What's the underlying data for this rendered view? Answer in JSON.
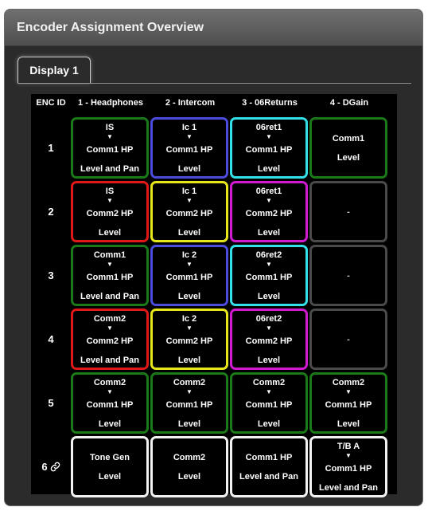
{
  "panel": {
    "title": "Encoder Assignment Overview"
  },
  "tabs": [
    {
      "label": "Display 1"
    }
  ],
  "grid": {
    "id_header": "ENC ID",
    "columns": [
      {
        "label": "1 - Headphones"
      },
      {
        "label": "2 - Intercom"
      },
      {
        "label": "3 - 06Returns"
      },
      {
        "label": "4 - DGain"
      }
    ],
    "colors": {
      "green": "#1a7a1a",
      "blue": "#4b4bdd",
      "cyan": "#33e0e8",
      "red": "#e01818",
      "yellow": "#e6e61a",
      "magenta": "#d21ad2",
      "gray": "#4a4a4a",
      "white": "#f2f2f2"
    },
    "arrow_glyph": "▼",
    "rows": [
      {
        "id": "1",
        "linked": false,
        "cells": [
          {
            "color": "green",
            "source": "IS",
            "target": "Comm1 HP",
            "mode": "Level and Pan"
          },
          {
            "color": "blue",
            "source": "Ic 1",
            "target": "Comm1 HP",
            "mode": "Level"
          },
          {
            "color": "cyan",
            "source": "06ret1",
            "target": "Comm1 HP",
            "mode": "Level"
          },
          {
            "color": "green",
            "source": "",
            "target": "Comm1",
            "mode": "Level"
          }
        ]
      },
      {
        "id": "2",
        "linked": false,
        "cells": [
          {
            "color": "red",
            "source": "IS",
            "target": "Comm2 HP",
            "mode": "Level"
          },
          {
            "color": "yellow",
            "source": "Ic 1",
            "target": "Comm2 HP",
            "mode": "Level"
          },
          {
            "color": "magenta",
            "source": "06ret1",
            "target": "Comm2 HP",
            "mode": "Level"
          },
          {
            "color": "gray",
            "empty": "-"
          }
        ]
      },
      {
        "id": "3",
        "linked": false,
        "cells": [
          {
            "color": "green",
            "source": "Comm1",
            "target": "Comm1 HP",
            "mode": "Level and Pan"
          },
          {
            "color": "blue",
            "source": "Ic 2",
            "target": "Comm1 HP",
            "mode": "Level"
          },
          {
            "color": "cyan",
            "source": "06ret2",
            "target": "Comm1 HP",
            "mode": "Level"
          },
          {
            "color": "gray",
            "empty": "-"
          }
        ]
      },
      {
        "id": "4",
        "linked": false,
        "cells": [
          {
            "color": "red",
            "source": "Comm2",
            "target": "Comm2 HP",
            "mode": "Level and Pan"
          },
          {
            "color": "yellow",
            "source": "Ic 2",
            "target": "Comm2 HP",
            "mode": "Level"
          },
          {
            "color": "magenta",
            "source": "06ret2",
            "target": "Comm2 HP",
            "mode": "Level"
          },
          {
            "color": "gray",
            "empty": "-"
          }
        ]
      },
      {
        "id": "5",
        "linked": false,
        "cells": [
          {
            "color": "green",
            "source": "Comm2",
            "target": "Comm1 HP",
            "mode": "Level"
          },
          {
            "color": "green",
            "source": "Comm2",
            "target": "Comm1 HP",
            "mode": "Level"
          },
          {
            "color": "green",
            "source": "Comm2",
            "target": "Comm1 HP",
            "mode": "Level"
          },
          {
            "color": "green",
            "source": "Comm2",
            "target": "Comm1 HP",
            "mode": "Level"
          }
        ]
      },
      {
        "id": "6",
        "linked": true,
        "cells": [
          {
            "color": "white",
            "source": "",
            "target": "Tone Gen",
            "mode": "Level"
          },
          {
            "color": "white",
            "source": "",
            "target": "Comm2",
            "mode": "Level"
          },
          {
            "color": "white",
            "source": "",
            "target": "Comm1 HP",
            "mode": "Level and Pan"
          },
          {
            "color": "white",
            "source": "T/B A",
            "target": "Comm1 HP",
            "mode": "Level and Pan"
          }
        ]
      }
    ]
  }
}
